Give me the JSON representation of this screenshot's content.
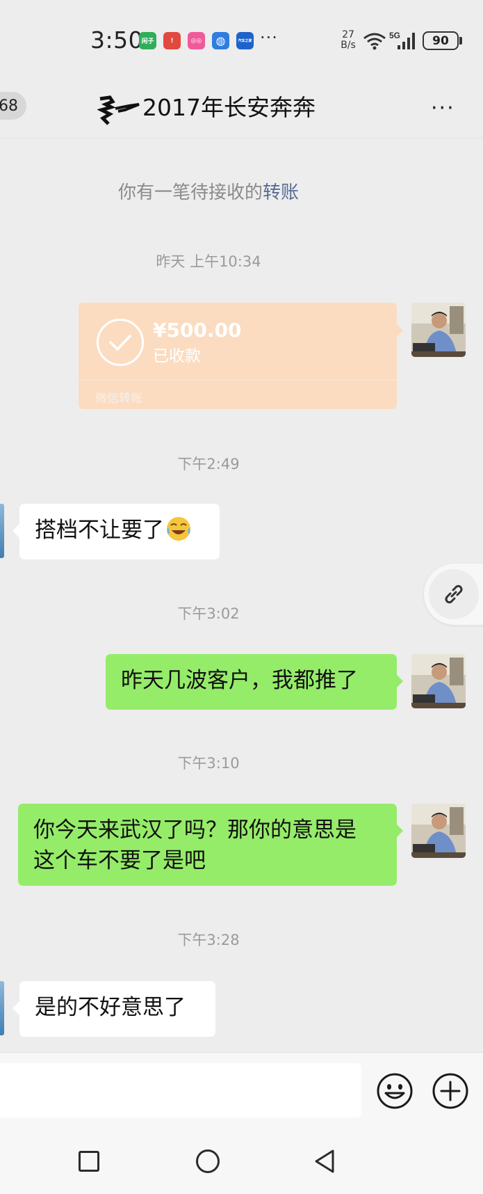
{
  "status_bar": {
    "time": "3:50",
    "app_icons": [
      {
        "icon": "app-green-icon",
        "label": "闲子",
        "color": "#2fae5a"
      },
      {
        "icon": "app-red-icon",
        "label": "!",
        "color": "#e2483d"
      },
      {
        "icon": "app-pink-icon",
        "label": "◎◎",
        "color": "#f05a9b"
      },
      {
        "icon": "browser-globe-icon",
        "label": "◍",
        "color": "#2f7de0"
      },
      {
        "icon": "app-blue-car-icon",
        "label": "汽车之家",
        "color": "#1e63c9"
      }
    ],
    "more": "···",
    "net_speed_value": "27",
    "net_speed_unit": "B/s",
    "network": "5G",
    "battery": "90"
  },
  "header": {
    "back_badge": "68",
    "title": "2017年长安奔奔",
    "more": "···"
  },
  "notice": {
    "text": "你有一笔待接收的",
    "link": "转账"
  },
  "messages": {
    "ts1": "昨天 上午10:34",
    "transfer": {
      "amount": "¥500.00",
      "status": "已收款",
      "footer": "微信转账"
    },
    "ts2": "下午2:49",
    "msg1": "搭档不让要了",
    "ts3": "下午3:02",
    "msg2": "昨天几波客户，我都推了",
    "ts4": "下午3:10",
    "msg3_line1": "你今天来武汉了吗？那你的意思是",
    "msg3_line2": "这个车不要了是吧",
    "ts5": "下午3:28",
    "msg4": "是的不好意思了"
  },
  "colors": {
    "chat_bg": "#ededed",
    "bubble_green": "#95ec69",
    "bubble_white": "#ffffff",
    "transfer_bg": "#fbdcc1",
    "link_blue": "#576b95"
  }
}
